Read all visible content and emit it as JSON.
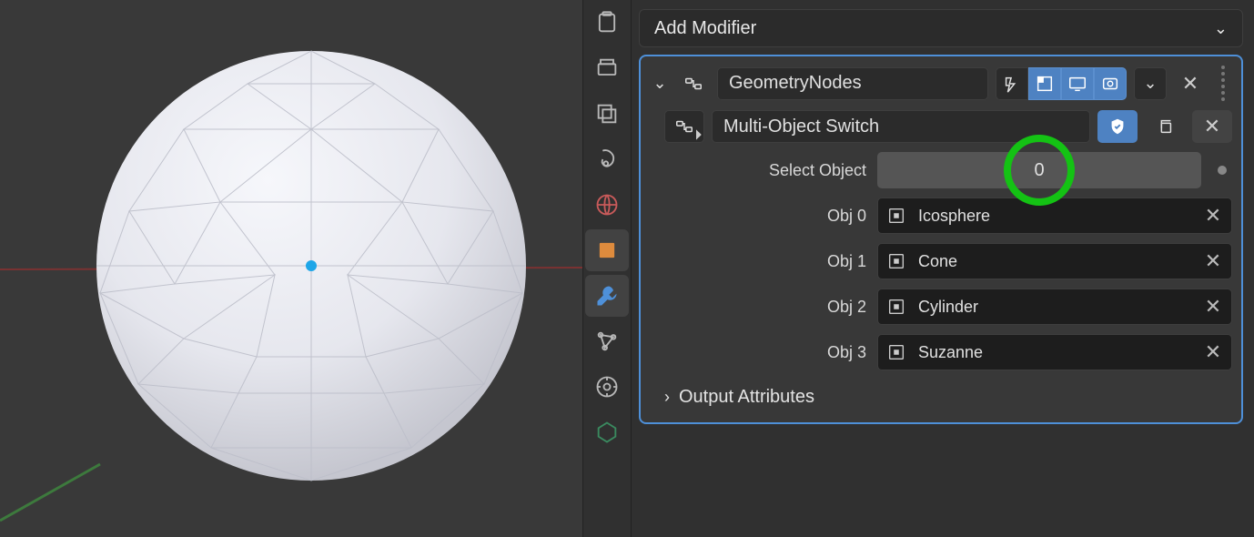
{
  "addModifier": {
    "label": "Add Modifier"
  },
  "modifier": {
    "name": "GeometryNodes",
    "nodeGroup": "Multi-Object Switch",
    "selectObject": {
      "label": "Select Object",
      "value": "0"
    },
    "slots": [
      {
        "label": "Obj 0",
        "value": "Icosphere"
      },
      {
        "label": "Obj 1",
        "value": "Cone"
      },
      {
        "label": "Obj 2",
        "value": "Cylinder"
      },
      {
        "label": "Obj 3",
        "value": "Suzanne"
      }
    ],
    "outputAttributes": "Output Attributes"
  },
  "tabs": [
    "render",
    "output",
    "view-layer",
    "scene-world",
    "scene-physics",
    "object",
    "modifiers",
    "particles",
    "physics-constraints",
    "data"
  ]
}
